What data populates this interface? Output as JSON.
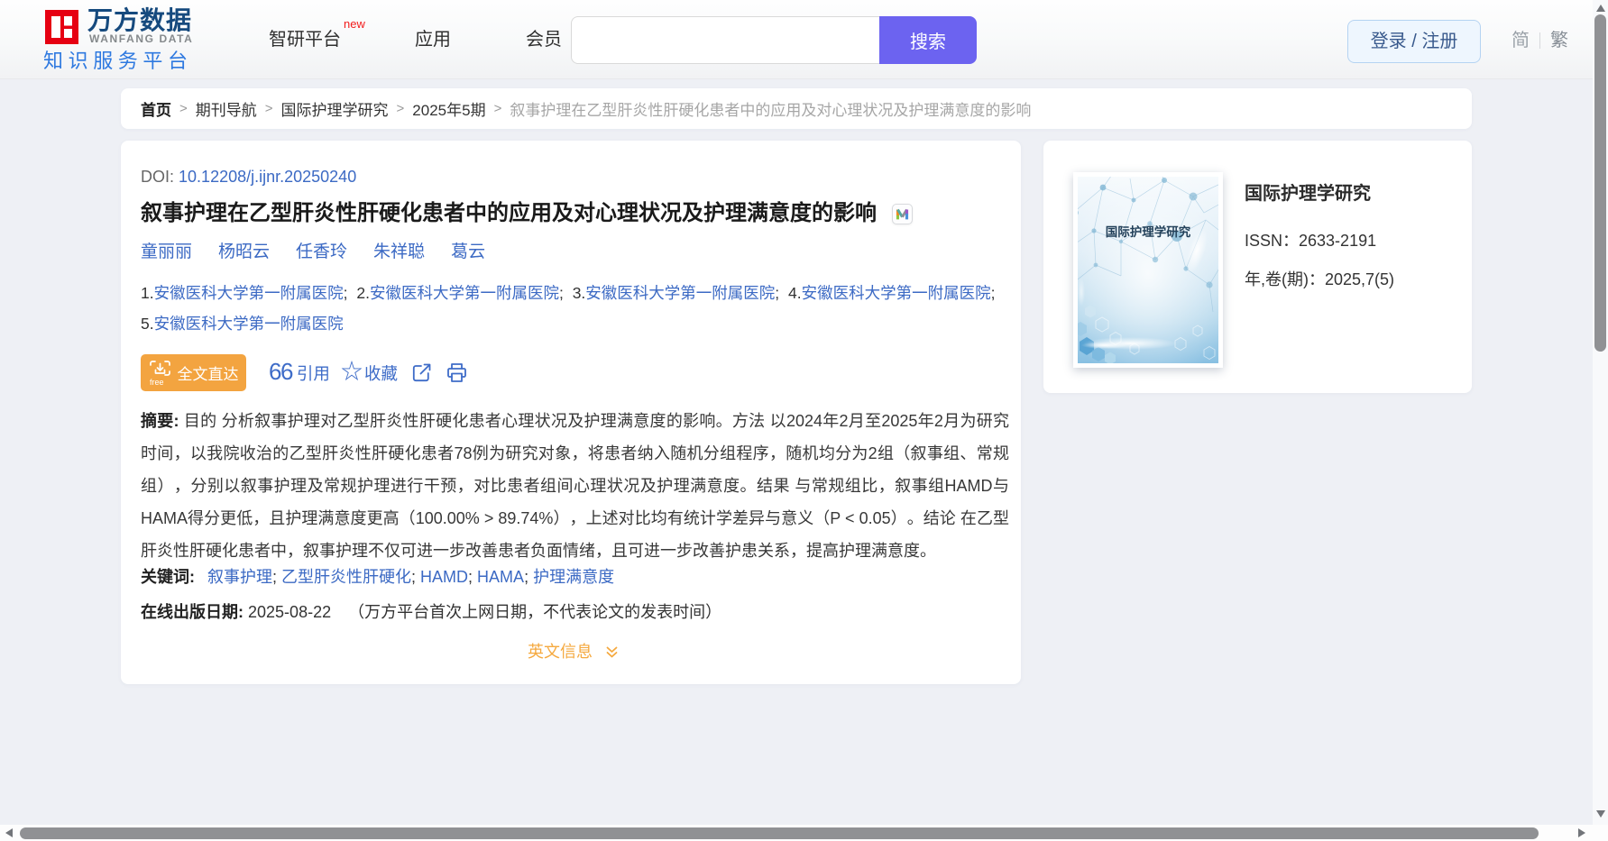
{
  "header": {
    "logo": {
      "brand_cn": "万方数据",
      "brand_en": "WANFANG DATA",
      "tagline": "知识服务平台"
    },
    "nav": {
      "zhiyan": "智研平台",
      "zhiyan_badge": "new",
      "app": "应用",
      "member": "会员"
    },
    "search": {
      "value": "",
      "placeholder": "",
      "button": "搜索"
    },
    "login_label": "登录 / 注册",
    "lang": {
      "simplified": "简",
      "traditional": "繁"
    }
  },
  "breadcrumb": {
    "separator": ">",
    "items": [
      "首页",
      "期刊导航",
      "国际护理学研究",
      "2025年5期",
      "叙事护理在乙型肝炎性肝硬化患者中的应用及对心理状况及护理满意度的影响"
    ]
  },
  "article": {
    "doi_label": "DOI:",
    "doi": "10.12208/j.ijnr.20250240",
    "title": "叙事护理在乙型肝炎性肝硬化患者中的应用及对心理状况及护理满意度的影响",
    "badge": "M",
    "authors": [
      "童丽丽",
      "杨昭云",
      "任香玲",
      "朱祥聪",
      "葛云"
    ],
    "affiliations": [
      {
        "index": "1.",
        "name": "安徽医科大学第一附属医院"
      },
      {
        "index": "2.",
        "name": "安徽医科大学第一附属医院"
      },
      {
        "index": "3.",
        "name": "安徽医科大学第一附属医院"
      },
      {
        "index": "4.",
        "name": "安徽医科大学第一附属医院"
      },
      {
        "index": "5.",
        "name": "安徽医科大学第一附属医院"
      }
    ],
    "affiliation_separator": "; ",
    "actions": {
      "fulltext": "全文直达",
      "fulltext_icon_note": "free",
      "cite": "引用",
      "favorite": "收藏"
    },
    "abstract_label": "摘要:",
    "abstract": "目的 分析叙事护理对乙型肝炎性肝硬化患者心理状况及护理满意度的影响。方法 以2024年2月至2025年2月为研究时间，以我院收治的乙型肝炎性肝硬化患者78例为研究对象，将患者纳入随机分组程序，随机均分为2组（叙事组、常规组），分别以叙事护理及常规护理进行干预，对比患者组间心理状况及护理满意度。结果 与常规组比，叙事组HAMD与HAMA得分更低，且护理满意度更高（100.00% > 89.74%），上述对比均有统计学差异与意义（P < 0.05）。结论 在乙型肝炎性肝硬化患者中，叙事护理不仅可进一步改善患者负面情绪，且可进一步改善护患关系，提高护理满意度。",
    "keywords_label": "关键词:",
    "keywords": [
      "叙事护理",
      "乙型肝炎性肝硬化",
      "HAMD",
      "HAMA",
      "护理满意度"
    ],
    "keyword_separator": "; ",
    "online_date_label": "在线出版日期:",
    "online_date": "2025-08-22",
    "online_date_note": "（万方平台首次上网日期，不代表论文的发表时间）",
    "english_toggle": "英文信息"
  },
  "journal": {
    "cover_title": "国际护理学研究",
    "name": "国际护理学研究",
    "issn_label": "ISSN：",
    "issn": "2633-2191",
    "volume_label": "年,卷(期)：",
    "volume": "2025,7(5)"
  },
  "colors": {
    "accent_purple": "#6c63f0",
    "accent_orange": "#f3a440",
    "link_blue": "#3c6ac4",
    "brand_red": "#e60012",
    "brand_navy": "#164a7e",
    "brand_blue": "#2e79e0",
    "page_bg": "#eef0f5"
  }
}
